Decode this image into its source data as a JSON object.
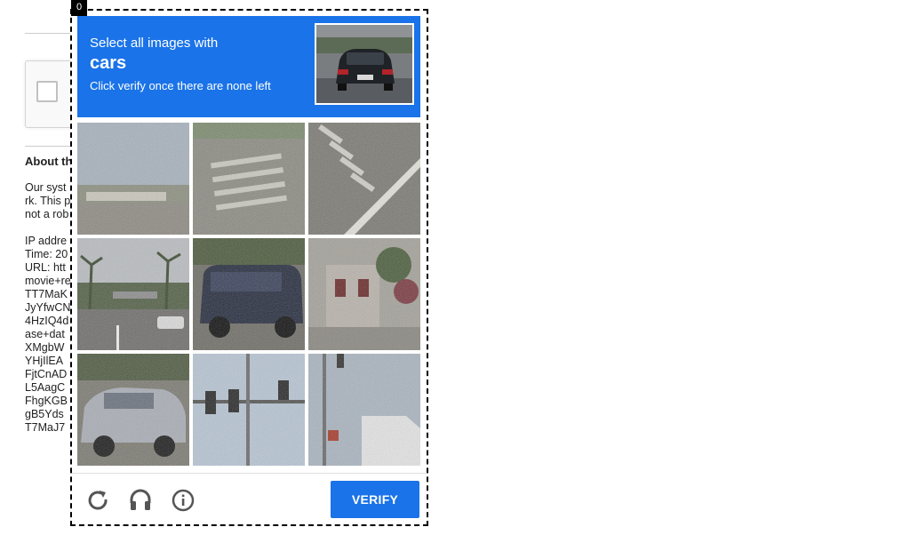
{
  "challenge_index": "0",
  "header": {
    "line1": "Select all images with",
    "keyword": "cars",
    "line3": "Click verify once there are none left",
    "sample_image": "car-rear-view"
  },
  "tiles": [
    {
      "subject": "sky-and-road-edge"
    },
    {
      "subject": "crosswalk-stripes"
    },
    {
      "subject": "crosswalk-diagonal"
    },
    {
      "subject": "street-with-palm-trees"
    },
    {
      "subject": "dark-suv"
    },
    {
      "subject": "building-with-flowers"
    },
    {
      "subject": "silver-sedan"
    },
    {
      "subject": "traffic-lights"
    },
    {
      "subject": "traffic-light-pole"
    }
  ],
  "footer": {
    "reload_icon": "reload-icon",
    "audio_icon": "headphones-icon",
    "info_icon": "info-icon",
    "verify_label": "VERIFY"
  },
  "background": {
    "about_heading": "About th",
    "about_lines": [
      "Our syst",
      "rk. This p",
      "not a rob"
    ],
    "ip_lines": [
      "IP addre",
      "Time: 20",
      "URL: htt",
      "movie+re",
      "TT7MaK",
      "JyYfwCN",
      "4HzIQ4d",
      "ase+dat",
      "XMgbW",
      "YHjIlEA",
      "FjtCnAD",
      "L5AagC",
      "FhgKGB",
      "gB5Yds",
      "T7MaJ7"
    ]
  },
  "colors": {
    "accent": "#1a73e8",
    "frame_border": "#000000"
  }
}
